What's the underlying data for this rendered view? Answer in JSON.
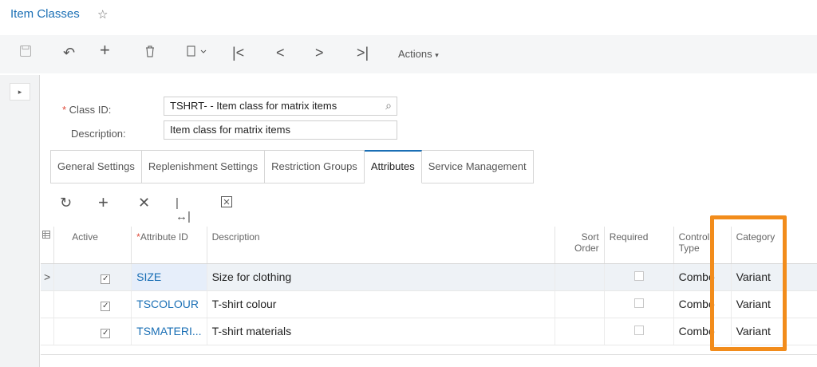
{
  "header": {
    "title": "Item Classes",
    "favorite_icon": "star-icon"
  },
  "toolbar": {
    "buttons": [
      "save-icon",
      "undo-icon",
      "add-icon",
      "delete-icon",
      "copy-paste-icon",
      "first-icon",
      "previous-icon",
      "next-icon",
      "last-icon"
    ],
    "actions_label": "Actions"
  },
  "form": {
    "class_id_label": "Class ID:",
    "class_id_value": "TSHRT- - Item class for matrix items",
    "description_label": "Description:",
    "description_value": "Item class for matrix items"
  },
  "tabs": [
    {
      "label": "General Settings"
    },
    {
      "label": "Replenishment Settings"
    },
    {
      "label": "Restriction Groups"
    },
    {
      "label": "Attributes",
      "active": true
    },
    {
      "label": "Service Management"
    }
  ],
  "grid": {
    "columns": {
      "active": "Active",
      "attribute_id": "Attribute ID",
      "description": "Description",
      "sort_order": "Sort Order",
      "required": "Required",
      "control_type": "Control Type",
      "category": "Category"
    },
    "rows": [
      {
        "active": true,
        "attribute_id": "SIZE",
        "description": "Size for clothing",
        "required": false,
        "control_type": "Combo",
        "category": "Variant"
      },
      {
        "active": true,
        "attribute_id": "TSCOLOUR",
        "description": "T-shirt colour",
        "required": false,
        "control_type": "Combo",
        "category": "Variant"
      },
      {
        "active": true,
        "attribute_id": "TSMATERI...",
        "description": "T-shirt materials",
        "required": false,
        "control_type": "Combo",
        "category": "Variant"
      }
    ]
  },
  "highlight_color": "#f28c1b",
  "accent_color": "#1a6fb5"
}
